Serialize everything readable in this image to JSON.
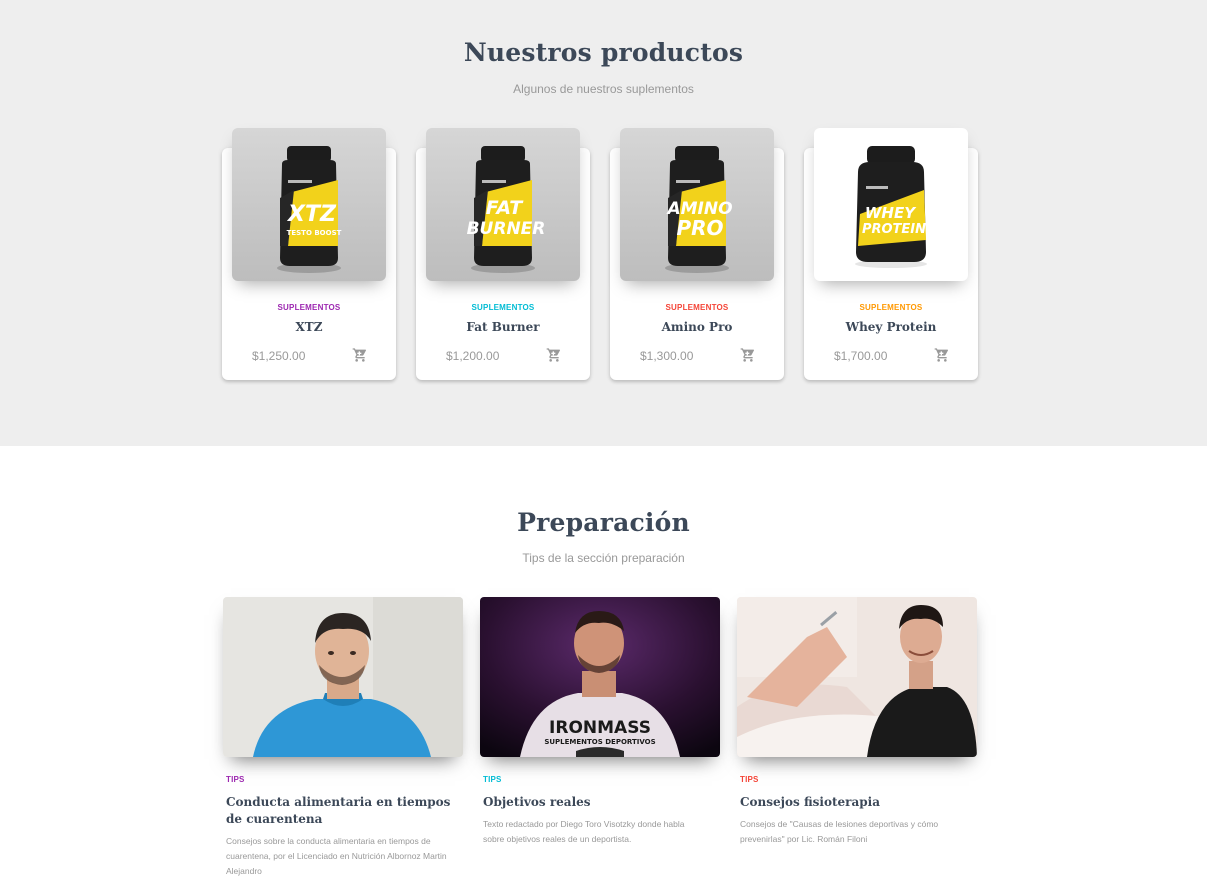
{
  "products": {
    "title": "Nuestros productos",
    "subtitle": "Algunos de nuestros suplementos",
    "items": [
      {
        "category": "SUPLEMENTOS",
        "category_color": "#9c27b0",
        "name": "XTZ",
        "price": "$1,250.00",
        "label_line1": "XTZ",
        "label_line2": "TESTO BOOST",
        "bg": "gray"
      },
      {
        "category": "SUPLEMENTOS",
        "category_color": "#00bcd4",
        "name": "Fat Burner",
        "price": "$1,200.00",
        "label_line1": "FAT",
        "label_line2": "BURNER",
        "bg": "gray"
      },
      {
        "category": "SUPLEMENTOS",
        "category_color": "#f44336",
        "name": "Amino Pro",
        "price": "$1,300.00",
        "label_line1": "AMINO",
        "label_line2": "PRO",
        "bg": "gray"
      },
      {
        "category": "SUPLEMENTOS",
        "category_color": "#ff9800",
        "name": "Whey Protein",
        "price": "$1,700.00",
        "label_line1": "WHEY",
        "label_line2": "PROTEIN",
        "bg": "white"
      }
    ]
  },
  "preparacion": {
    "title": "Preparación",
    "subtitle": "Tips de la sección preparación",
    "items": [
      {
        "category": "TIPS",
        "category_color": "#9c27b0",
        "title": "Conducta alimentaria en tiempos de cuarentena",
        "description": "Consejos sobre la conducta alimentaria en tiempos de cuarentena, por el Licenciado en Nutrición Albornoz Martin Alejandro"
      },
      {
        "category": "TIPS",
        "category_color": "#00bcd4",
        "title": "Objetivos reales",
        "description": "Texto redactado por Diego Toro Visotzky donde habla sobre objetivos reales de un deportista.",
        "shirt_text": "IRONMASS",
        "shirt_sub": "SUPLEMENTOS DEPORTIVOS"
      },
      {
        "category": "TIPS",
        "category_color": "#f44336",
        "title": "Consejos fisioterapia",
        "description": "Consejos de \"Causas de lesiones deportivas y cómo prevenirlas\" por Lic. Román Filoni"
      }
    ]
  },
  "icons": {
    "cart": "shopping-cart-icon"
  }
}
